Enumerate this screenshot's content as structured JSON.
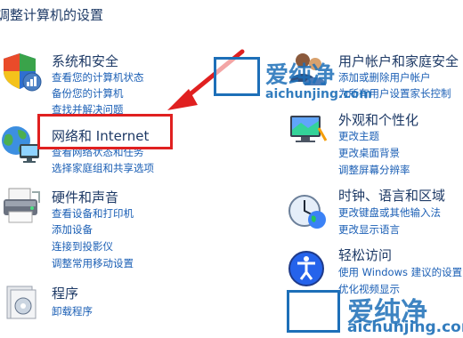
{
  "page": {
    "title": "调整计算机的设置"
  },
  "categories": [
    {
      "key": "system",
      "title": "系统和安全",
      "links": [
        "查看您的计算机状态",
        "备份您的计算机",
        "查找并解决问题"
      ]
    },
    {
      "key": "network",
      "title": "网络和 Internet",
      "links": [
        "查看网络状态和任务",
        "选择家庭组和共享选项"
      ]
    },
    {
      "key": "hardware",
      "title": "硬件和声音",
      "links": [
        "查看设备和打印机",
        "添加设备",
        "连接到投影仪",
        "调整常用移动设置"
      ]
    },
    {
      "key": "programs",
      "title": "程序",
      "links": [
        "卸载程序"
      ]
    },
    {
      "key": "users",
      "title": "用户帐户和家庭安全",
      "links": [
        "添加或删除用户帐户",
        "为所有用户设置家长控制"
      ]
    },
    {
      "key": "appearance",
      "title": "外观和个性化",
      "links": [
        "更改主题",
        "更改桌面背景",
        "调整屏幕分辨率"
      ]
    },
    {
      "key": "clock",
      "title": "时钟、语言和区域",
      "links": [
        "更改键盘或其他输入法",
        "更改显示语言"
      ]
    },
    {
      "key": "ease",
      "title": "轻松访问",
      "links": [
        "使用 Windows 建议的设置",
        "优化视频显示"
      ]
    }
  ],
  "watermark": {
    "brand_cn": "爱纯净",
    "url": "aichunjing.com",
    "color": "#1d6fb8"
  },
  "annotation": {
    "color": "#e02020"
  },
  "colors": {
    "title": "#1e3a66",
    "link": "#1b5fb5"
  }
}
